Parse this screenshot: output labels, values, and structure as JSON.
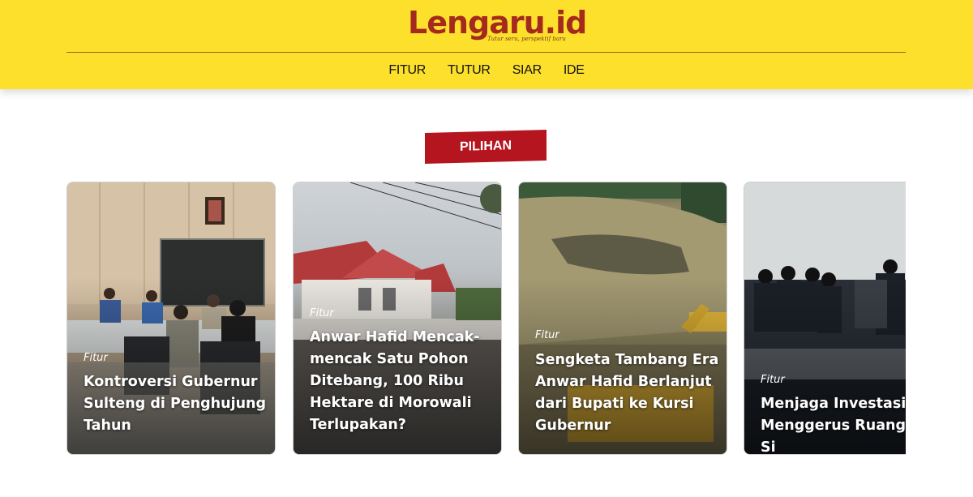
{
  "header": {
    "logo_text": "Lengaru.id",
    "tagline": "Tutur seru, perspektif baru",
    "nav": [
      "FITUR",
      "TUTUR",
      "SIAR",
      "IDE"
    ]
  },
  "section": {
    "label": "PILIHAN"
  },
  "cards": [
    {
      "category": "Fitur",
      "title": "Kontroversi Gubernur Sulteng di Penghujung Tahun"
    },
    {
      "category": "Fitur",
      "title": "Anwar Hafid Mencak-mencak Satu Pohon Ditebang, 100 Ribu Hektare di Morowali Terlupakan?"
    },
    {
      "category": "Fitur",
      "title": "Sengketa Tambang Era Anwar Hafid Berlanjut dari Bupati ke Kursi Gubernur"
    },
    {
      "category": "Fitur",
      "title": "Menjaga Investasi, Menggerus Ruang Si"
    }
  ],
  "colors": {
    "header_bg": "#fde02b",
    "logo": "#a52a1e",
    "badge_bg": "#b5151f"
  }
}
